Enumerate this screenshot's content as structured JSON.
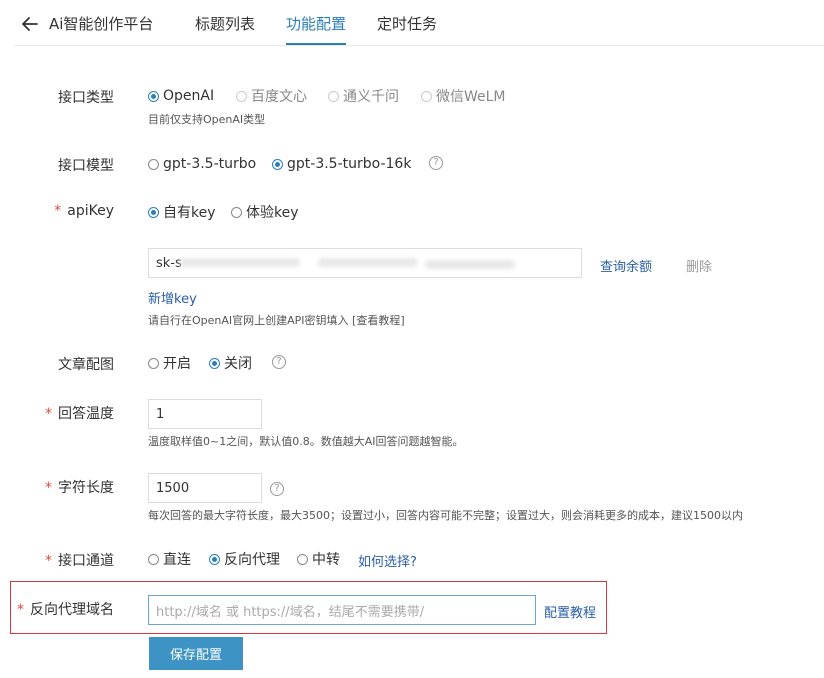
{
  "header": {
    "back_icon": "arrow-left-icon",
    "app_title": "Ai智能创作平台",
    "tabs": [
      {
        "label": "标题列表",
        "active": false
      },
      {
        "label": "功能配置",
        "active": true
      },
      {
        "label": "定时任务",
        "active": false
      }
    ]
  },
  "colors": {
    "accent": "#2a7fb8",
    "required": "#e24a3b",
    "button": "#3d93c4",
    "highlight_border": "#d9363e"
  },
  "form": {
    "api_type": {
      "label": "接口类型",
      "options": [
        "OpenAI",
        "百度文心",
        "通义千问",
        "微信WeLM"
      ],
      "selected": "OpenAI",
      "hint": "目前仅支持OpenAI类型"
    },
    "api_model": {
      "label": "接口模型",
      "options": [
        "gpt-3.5-turbo",
        "gpt-3.5-turbo-16k"
      ],
      "selected": "gpt-3.5-turbo-16k",
      "help_icon": "question-circle-icon",
      "help_text": "?"
    },
    "api_key": {
      "required_mark": "*",
      "label": "apiKey",
      "options": [
        "自有key",
        "体验key"
      ],
      "selected": "自有key",
      "key_value_prefix": "sk-s",
      "query_balance": "查询余额",
      "delete": "删除",
      "add_key": "新增key",
      "hint": "请自行在OpenAI官网上创建API密钥填入 [查看教程]"
    },
    "article_image": {
      "label": "文章配图",
      "options": [
        "开启",
        "关闭"
      ],
      "selected": "关闭",
      "help_text": "?"
    },
    "temperature": {
      "required_mark": "*",
      "label": "回答温度",
      "value": "1",
      "hint": "温度取样值0~1之间，默认值0.8。数值越大AI回答问题越智能。"
    },
    "max_length": {
      "required_mark": "*",
      "label": "字符长度",
      "value": "1500",
      "help_text": "?",
      "hint": "每次回答的最大字符长度，最大3500；设置过小，回答内容可能不完整；设置过大，则会消耗更多的成本，建议1500以内"
    },
    "channel": {
      "required_mark": "*",
      "label": "接口通道",
      "options": [
        "直连",
        "反向代理",
        "中转"
      ],
      "selected": "反向代理",
      "how_to_choose": "如何选择?"
    },
    "proxy_domain": {
      "required_mark": "*",
      "label": "反向代理域名",
      "placeholder": "http://域名 或 https://域名，结尾不需要携带/",
      "tutorial": "配置教程"
    },
    "save_label": "保存配置"
  }
}
